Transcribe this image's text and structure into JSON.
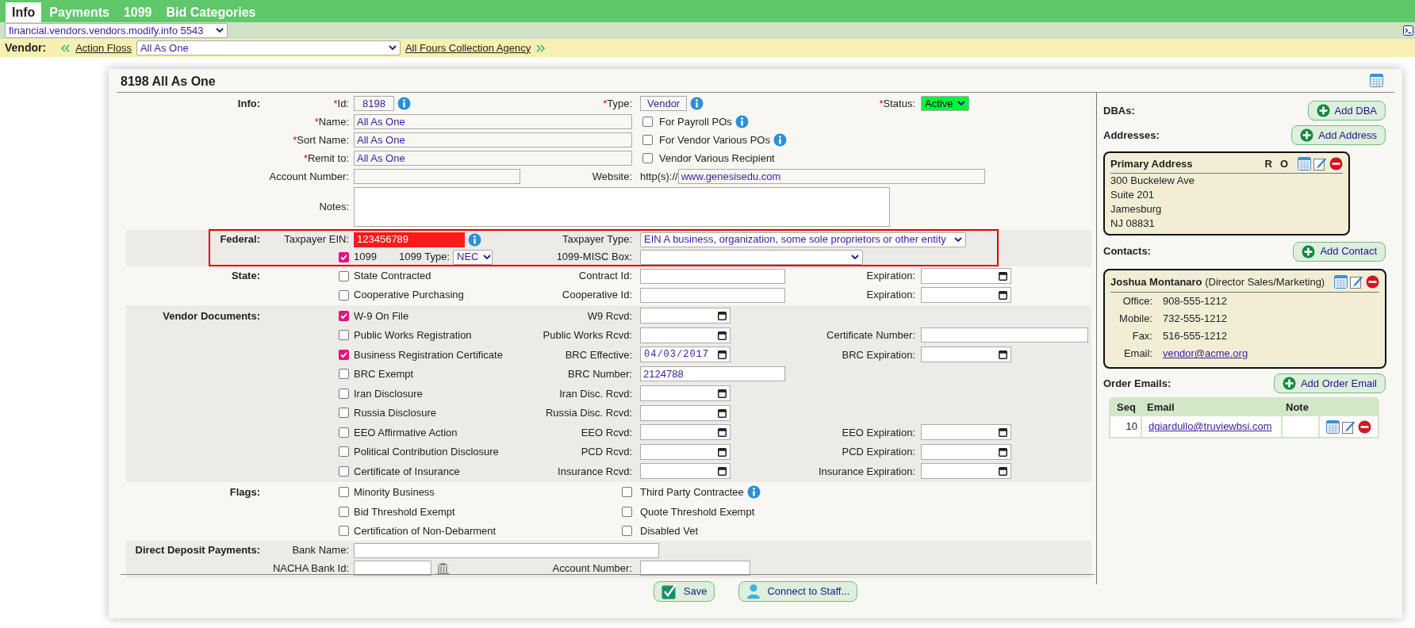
{
  "tabs": [
    {
      "label": "Info",
      "selected": true
    },
    {
      "label": "Payments",
      "selected": false
    },
    {
      "label": "1099",
      "selected": false
    },
    {
      "label": "Bid Categories",
      "selected": false
    }
  ],
  "route_select": {
    "value": "financial.vendors.vendors.modify.info 5543"
  },
  "vendor_nav": {
    "label": "Vendor:",
    "previous": "Action Floss",
    "current": "All As One",
    "next": "All Fours Collection Agency"
  },
  "panel": {
    "title": "8198 All As One"
  },
  "info": {
    "section": "Info:",
    "id": {
      "required_mark": "*",
      "label": "Id:",
      "value": "8198"
    },
    "type": {
      "required_mark": "*",
      "label": "Type:",
      "value": "Vendor"
    },
    "status": {
      "required_mark": "*",
      "label": "Status:",
      "value": "Active"
    },
    "name": {
      "required_mark": "*",
      "label": "Name:",
      "value": "All As One"
    },
    "sort_name": {
      "required_mark": "*",
      "label": "Sort Name:",
      "value": "All As One"
    },
    "remit_to": {
      "required_mark": "*",
      "label": "Remit to:",
      "value": "All As One"
    },
    "options": [
      {
        "label": "For Payroll POs",
        "checked": false,
        "info": true
      },
      {
        "label": "For Vendor Various POs",
        "checked": false,
        "info": true
      },
      {
        "label": "Vendor Various Recipient",
        "checked": false
      }
    ],
    "account_number": {
      "label": "Account Number:"
    },
    "website": {
      "label": "Website:",
      "prefix": "http(s)://",
      "value": "www.genesisedu.com"
    },
    "notes": {
      "label": "Notes:"
    }
  },
  "federal": {
    "section": "Federal:",
    "ein": {
      "label": "Taxpayer EIN:",
      "value": "123456789",
      "invalid": true
    },
    "taxpayer_type": {
      "label": "Taxpayer Type:",
      "value": "EIN A business, organization, some sole proprietors or other entity"
    },
    "is_1099": {
      "label": "1099",
      "checked": true
    },
    "type_1099": {
      "label": "1099 Type:",
      "value": "NEC"
    },
    "misc_box": {
      "label": "1099-MISC Box:"
    }
  },
  "state": {
    "section": "State:",
    "rows": [
      {
        "label": "State Contracted",
        "checked": false,
        "id_label": "Contract Id:",
        "expiration_label": "Expiration:"
      },
      {
        "label": "Cooperative Purchasing",
        "checked": false,
        "id_label": "Cooperative Id:",
        "expiration_label": "Expiration:"
      }
    ]
  },
  "vendor_documents": {
    "section": "Vendor Documents:",
    "rows": [
      {
        "label": "W-9 On File",
        "checked": true,
        "field": {
          "label": "W9 Rcvd:",
          "kind": "date"
        }
      },
      {
        "label": "Public Works Registration",
        "checked": false,
        "field": {
          "label": "Public Works Rcvd:",
          "kind": "date"
        },
        "extra": {
          "label": "Certificate Number:",
          "kind": "text"
        }
      },
      {
        "label": "Business Registration Certificate",
        "checked": true,
        "field": {
          "label": "BRC Effective:",
          "kind": "date",
          "value": "04/03/2017"
        },
        "extra": {
          "label": "BRC Expiration:",
          "kind": "date"
        }
      },
      {
        "label": "BRC Exempt",
        "checked": false,
        "field": {
          "label": "BRC Number:",
          "kind": "text",
          "value": "2124788"
        }
      },
      {
        "label": "Iran Disclosure",
        "checked": false,
        "field": {
          "label": "Iran Disc. Rcvd:",
          "kind": "date"
        }
      },
      {
        "label": "Russia Disclosure",
        "checked": false,
        "field": {
          "label": "Russia Disc. Rcvd:",
          "kind": "date"
        }
      },
      {
        "label": "EEO Affirmative Action",
        "checked": false,
        "field": {
          "label": "EEO Rcvd:",
          "kind": "date"
        },
        "extra": {
          "label": "EEO Expiration:",
          "kind": "date"
        }
      },
      {
        "label": "Political Contribution Disclosure",
        "checked": false,
        "field": {
          "label": "PCD Rcvd:",
          "kind": "date"
        },
        "extra": {
          "label": "PCD Expiration:",
          "kind": "date"
        }
      },
      {
        "label": "Certificate of Insurance",
        "checked": false,
        "field": {
          "label": "Insurance Rcvd:",
          "kind": "date"
        },
        "extra": {
          "label": "Insurance Expiration:",
          "kind": "date"
        }
      }
    ]
  },
  "flags": {
    "section": "Flags:",
    "rows": [
      {
        "left": {
          "label": "Minority Business",
          "checked": false
        },
        "right": {
          "label": "Third Party Contractee",
          "checked": false,
          "info": true
        }
      },
      {
        "left": {
          "label": "Bid Threshold Exempt",
          "checked": false
        },
        "right": {
          "label": "Quote Threshold Exempt",
          "checked": false
        }
      },
      {
        "left": {
          "label": "Certification of Non-Debarment",
          "checked": false
        },
        "right": {
          "label": "Disabled Vet",
          "checked": false
        }
      }
    ]
  },
  "direct_deposit": {
    "section": "Direct Deposit Payments:",
    "bank_name": {
      "label": "Bank Name:"
    },
    "nacha": {
      "label": "NACHA Bank Id:"
    },
    "account_number": {
      "label": "Account Number:"
    }
  },
  "buttons": [
    {
      "label": "Save",
      "kind": "save"
    },
    {
      "label": "Connect to Staff...",
      "kind": "staff"
    }
  ],
  "sidebar": {
    "dbas": {
      "label": "DBAs:",
      "button": "Add DBA"
    },
    "addresses": {
      "label": "Addresses:",
      "button": "Add Address",
      "items": [
        {
          "title": "Primary Address",
          "flags": [
            "R",
            "O"
          ],
          "lines": [
            "300 Buckelew Ave",
            "Suite 201",
            "Jamesburg",
            "NJ 08831"
          ]
        }
      ]
    },
    "contacts": {
      "label": "Contacts:",
      "button": "Add Contact",
      "items": [
        {
          "name": "Joshua Montanaro",
          "role": "(Director Sales/Marketing)",
          "details": [
            {
              "label": "Office:",
              "value": "908-555-1212",
              "kind": "text"
            },
            {
              "label": "Mobile:",
              "value": "732-555-1212",
              "kind": "text"
            },
            {
              "label": "Fax:",
              "value": "516-555-1212",
              "kind": "text"
            },
            {
              "label": "Email:",
              "value": "vendor@acme.org",
              "kind": "link"
            }
          ]
        }
      ]
    },
    "order_emails": {
      "label": "Order Emails:",
      "button": "Add Order Email",
      "columns": [
        "Seq",
        "Email",
        "Note"
      ],
      "rows": [
        {
          "seq": "10",
          "email": "dgiardullo@truviewbsi.com"
        }
      ]
    }
  }
}
